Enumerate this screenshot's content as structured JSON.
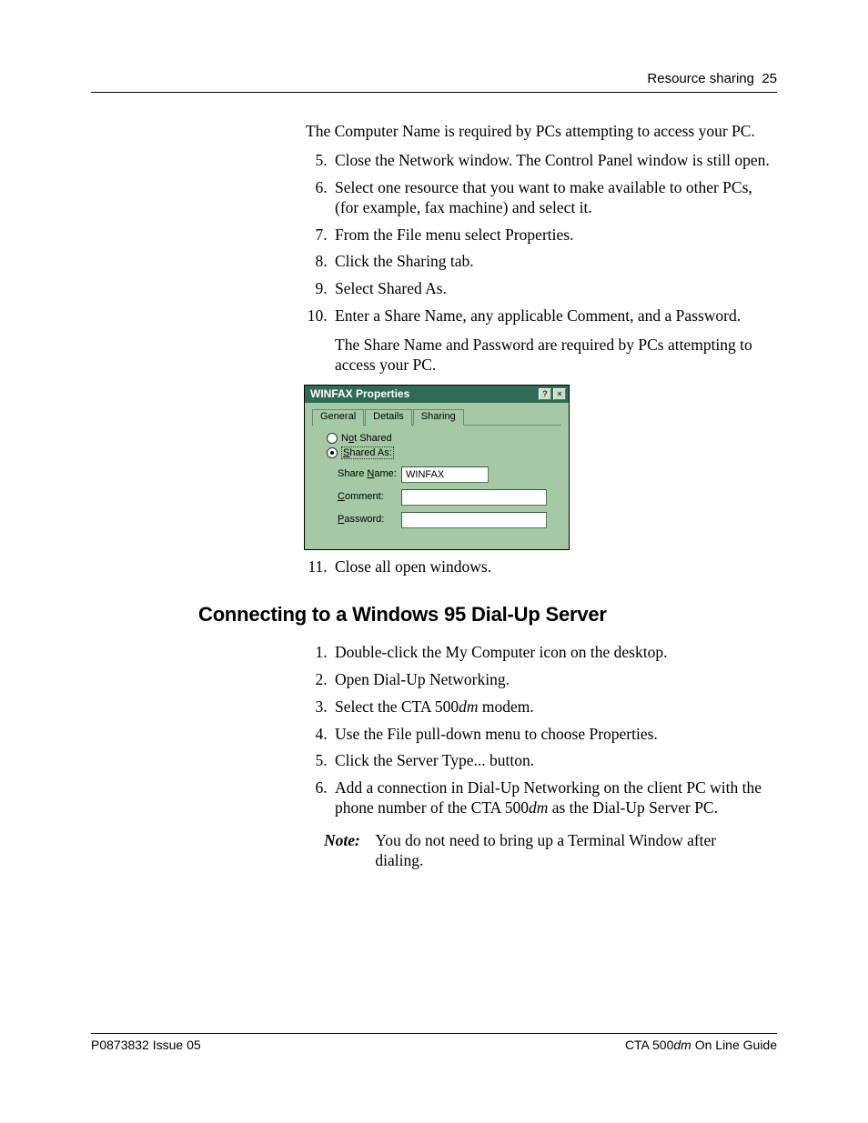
{
  "header": {
    "section": "Resource sharing",
    "page": "25"
  },
  "intro_para": "The Computer Name is required by PCs attempting to access your PC.",
  "stepsA": {
    "start": 5,
    "items": [
      {
        "text": "Close the Network window. The Control Panel window is still open."
      },
      {
        "text": "Select one resource that you want to make available to other PCs, (for example, fax machine) and select it."
      },
      {
        "text": "From the File menu select Properties."
      },
      {
        "text": "Click the Sharing tab."
      },
      {
        "text": "Select Shared As."
      },
      {
        "text": "Enter a Share Name, any applicable Comment, and a Password.",
        "after": "The Share Name and Password are required by PCs attempting to access your PC."
      }
    ]
  },
  "stepsA_tail": {
    "start": 11,
    "items": [
      {
        "text": "Close all open windows."
      }
    ]
  },
  "dialog": {
    "title": "WINFAX Properties",
    "help_btn": "?",
    "close_btn": "×",
    "tabs": [
      "General",
      "Details",
      "Sharing"
    ],
    "active_tab": "Sharing",
    "radios": {
      "not_shared_html": "N<span class='u'>o</span>t Shared",
      "shared_as_html": "<span class='u'>S</span>hared As:"
    },
    "fields": {
      "share_name_label_html": "Share <span class='u'>N</span>ame:",
      "share_name_value": "WINFAX",
      "comment_label_html": "<span class='u'>C</span>omment:",
      "comment_value": "",
      "password_label_html": "<span class='u'>P</span>assword:",
      "password_value": ""
    }
  },
  "heading2": "Connecting to a Windows 95 Dial-Up Server",
  "stepsB": {
    "start": 1,
    "items": [
      {
        "text": "Double-click the My Computer icon on the desktop."
      },
      {
        "text": "Open Dial-Up Networking."
      },
      {
        "html": "Select the CTA 500<span class='dm'>dm</span> modem."
      },
      {
        "text": "Use the File pull-down menu to choose Properties."
      },
      {
        "text": "Click the Server Type... button."
      },
      {
        "html": "Add a connection in Dial-Up Networking on the client PC with the phone number of the CTA 500<span class='dm'>dm</span> as the Dial-Up Server PC."
      }
    ]
  },
  "note": {
    "label": "Note:",
    "body": "You do not need to bring up a Terminal Window after dialing."
  },
  "footer": {
    "left": "P0873832  Issue 05",
    "right_html": "CTA 500<span class='dm'>dm</span> On Line Guide"
  }
}
